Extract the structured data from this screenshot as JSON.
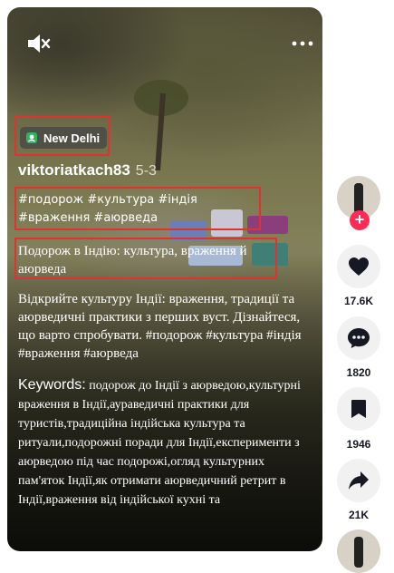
{
  "location": {
    "label": "New Delhi"
  },
  "author": {
    "username": "viktoriatkach83",
    "date": "5-3"
  },
  "hashtags": "#подорож #культура #індія #враження #аюрведа",
  "title": "Подорож в Індію: культура, враження й аюрведа",
  "description": "Відкрийте культуру Індії: враження, традиції та аюрведичні практики з перших вуст. Дізнайтеся, що варто спробувати. #подорож #культура #індія #враження #аюрведа",
  "keywords": {
    "label": "Keywords:",
    "text": " подорож до Індії з аюрведою,культурні враження в Індії,аураведичні практики для туристів,традиційна індійська культура та ритуали,подорожні поради для Індії,експерименти з аюрведою під час подорожі,огляд культурних пам'яток Індії,як отримати аюрведичний ретрит в Індії,враження від індійської кухні та"
  },
  "actions": {
    "likes": "17.6K",
    "comments": "1820",
    "saves": "1946",
    "shares": "21K"
  },
  "follow_label": "+",
  "colors": {
    "accent": "#fe2c55",
    "highlight_box": "#e0332f"
  },
  "icons": [
    "mute-icon",
    "more-icon",
    "location-pin-icon",
    "heart-icon",
    "comment-icon",
    "bookmark-icon",
    "share-icon"
  ]
}
